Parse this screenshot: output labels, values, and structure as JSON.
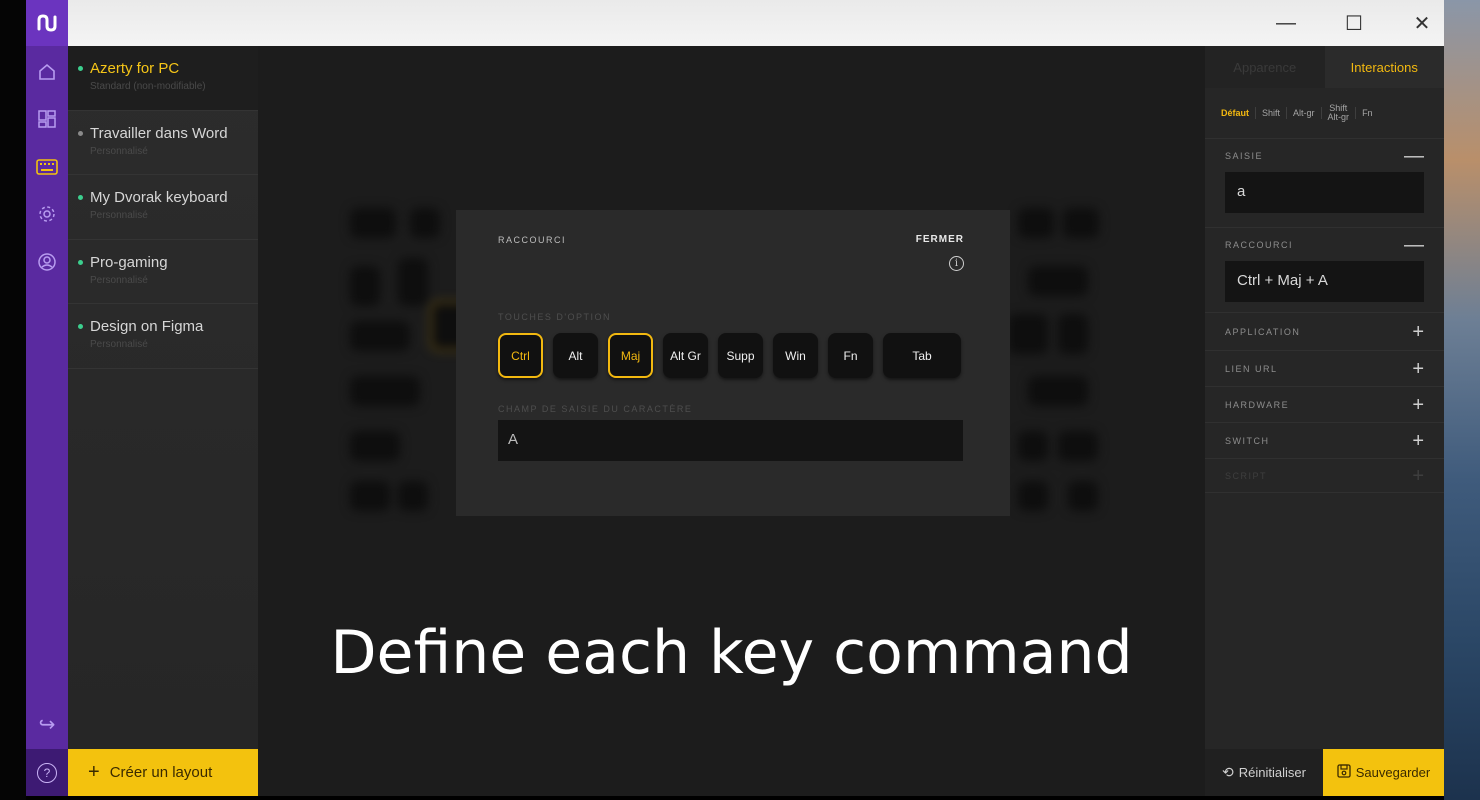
{
  "window": {
    "controls": {
      "minimize": "—",
      "maximize": "☐",
      "close": "✕"
    }
  },
  "rail": {
    "logo_glyph": "ᔓ",
    "icons": [
      "home-icon",
      "dashboard-icon",
      "keyboard-icon",
      "settings-icon",
      "user-icon",
      "logout-icon"
    ],
    "help_glyph": "?",
    "logout_glyph": "↪"
  },
  "layouts": {
    "items": [
      {
        "name": "Azerty for PC",
        "sub": "Standard (non-modifiable)",
        "dot_color": "#3ccf8e"
      },
      {
        "name": "Travailler dans Word",
        "sub": "Personnalisé",
        "dot_color": "#8a8a8a"
      },
      {
        "name": "My Dvorak keyboard",
        "sub": "Personnalisé",
        "dot_color": "#3ccf8e"
      },
      {
        "name": "Pro-gaming",
        "sub": "Personnalisé",
        "dot_color": "#3ccf8e"
      },
      {
        "name": "Design on Figma",
        "sub": "Personnalisé",
        "dot_color": "#3ccf8e"
      }
    ],
    "create_plus": "+",
    "create_label": "Créer un layout"
  },
  "dialog": {
    "title": "RACCOURCI",
    "close_label": "FERMER",
    "info_glyph": "i",
    "options_label": "TOUCHES D'OPTION",
    "options": [
      "Ctrl",
      "Alt",
      "Maj",
      "Alt Gr",
      "Supp",
      "Win",
      "Fn",
      "Tab"
    ],
    "selected": [
      "Ctrl",
      "Maj"
    ],
    "char_label": "CHAMP DE SAISIE DU CARACTÈRE",
    "char_value": "A"
  },
  "caption": "Define each key command",
  "panel": {
    "tabs": [
      "Apparence",
      "Interactions"
    ],
    "active_tab": "Interactions",
    "modifiers": [
      {
        "line1": "Défaut",
        "line2": ""
      },
      {
        "line1": "Shift",
        "line2": ""
      },
      {
        "line1": "Alt-gr",
        "line2": ""
      },
      {
        "line1": "Shift",
        "line2": "Alt-gr"
      },
      {
        "line1": "Fn",
        "line2": ""
      }
    ],
    "sections": {
      "saisie": {
        "label": "SAISIE",
        "toggle": "—",
        "value": "a"
      },
      "raccourci": {
        "label": "RACCOURCI",
        "toggle": "—",
        "value": "Ctrl + Maj + A"
      },
      "application": {
        "label": "APPLICATION",
        "toggle": "+"
      },
      "lien_url": {
        "label": "LIEN URL",
        "toggle": "+"
      },
      "hardware": {
        "label": "HARDWARE",
        "toggle": "+"
      },
      "switch": {
        "label": "SWITCH",
        "toggle": "+"
      },
      "script": {
        "label": "SCRIPT",
        "toggle": "+"
      }
    },
    "reset_label": "Réinitialiser",
    "save_label": "Sauvegarder"
  },
  "colors": {
    "accent": "#f3c20e",
    "rail": "#5a2aa0",
    "active_dot": "#3ccf8e"
  }
}
